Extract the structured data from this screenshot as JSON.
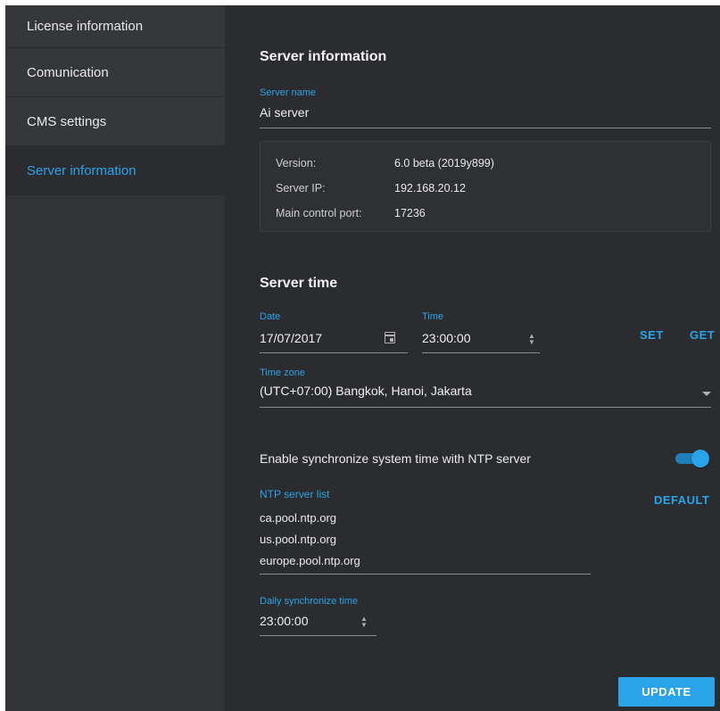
{
  "sidebar": {
    "items": [
      {
        "label": "License information",
        "active": false
      },
      {
        "label": "Comunication",
        "active": false
      },
      {
        "label": "CMS settings",
        "active": false
      },
      {
        "label": "Server information",
        "active": true
      }
    ]
  },
  "server_info": {
    "title": "Server information",
    "server_name_label": "Server name",
    "server_name_value": "Ai server",
    "version_label": "Version:",
    "version_value": "6.0 beta (2019y899)",
    "ip_label": "Server IP:",
    "ip_value": "192.168.20.12",
    "port_label": "Main control port:",
    "port_value": "17236"
  },
  "server_time": {
    "title": "Server time",
    "date_label": "Date",
    "date_value": "17/07/2017",
    "time_label": "Time",
    "time_value": "23:00:00",
    "set_label": "SET",
    "get_label": "GET",
    "timezone_label": "Time zone",
    "timezone_value": "(UTC+07:00) Bangkok, Hanoi, Jakarta"
  },
  "ntp": {
    "enable_label": "Enable synchronize system time with NTP server",
    "enabled": true,
    "list_label": "NTP server list",
    "default_label": "DEFAULT",
    "servers": [
      "ca.pool.ntp.org",
      "us.pool.ntp.org",
      "europe.pool.ntp.org"
    ],
    "daily_label": "Daily synchronize time",
    "daily_value": "23:00:00"
  },
  "actions": {
    "update_label": "UPDATE"
  },
  "colors": {
    "accent": "#2ba3e8",
    "background": "#2b2c30",
    "sidebar": "#313337"
  }
}
